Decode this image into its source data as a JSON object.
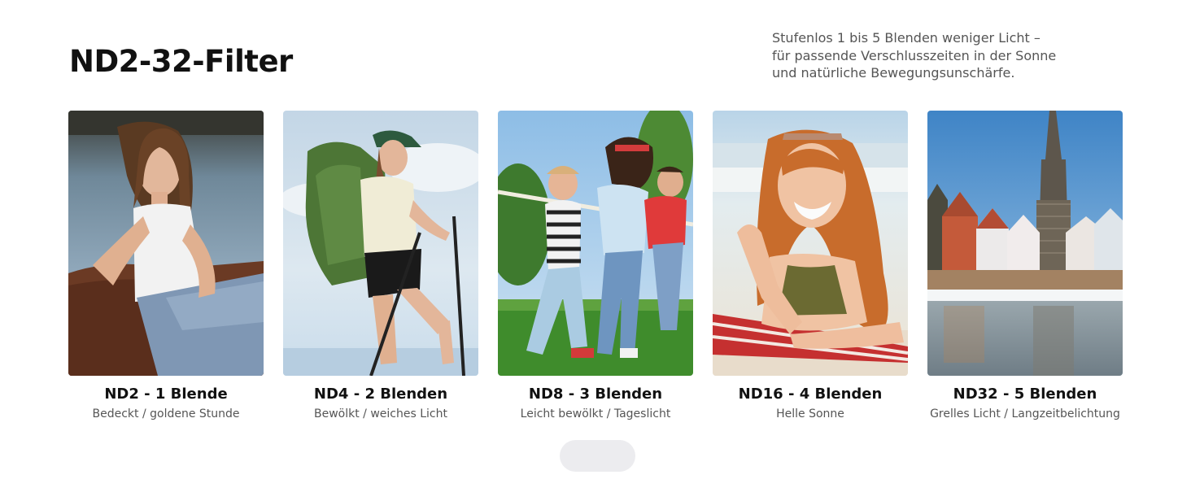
{
  "header": {
    "title": "ND2-32-Filter",
    "intro_lines": [
      "Stufenlos 1 bis 5 Blenden weniger Licht –",
      "für passende Verschlusszeiten in der Sonne",
      "und natürliche Bewegungsunschärfe."
    ]
  },
  "cards": [
    {
      "title": "ND2 - 1 Blende",
      "subtitle": "Bedeckt / goldene Stunde",
      "image": "woman-leaning-on-log-photo"
    },
    {
      "title": "ND4 - 2 Blenden",
      "subtitle": "Bewölkt / weiches Licht",
      "image": "hiker-with-backpack-photo"
    },
    {
      "title": "ND8 - 3 Blenden",
      "subtitle": "Leicht bewölkt / Tageslicht",
      "image": "children-tug-of-war-photo"
    },
    {
      "title": "ND16 - 4 Blenden",
      "subtitle": "Helle Sonne",
      "image": "smiling-woman-on-beach-photo"
    },
    {
      "title": "ND32 - 5 Blenden",
      "subtitle": "Grelles Licht / Langzeitbelichtung",
      "image": "cathedral-river-town-photo"
    }
  ],
  "pager": {
    "label": ""
  },
  "colors": {
    "title": "#111111",
    "body_text": "#555555",
    "pager_bg": "#ececef"
  }
}
